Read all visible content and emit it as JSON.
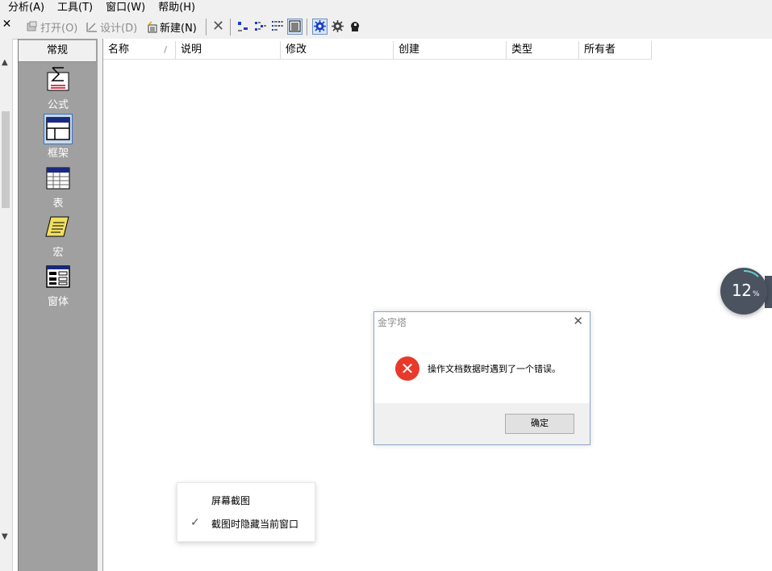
{
  "menu": [
    "分析(A)",
    "工具(T)",
    "窗口(W)",
    "帮助(H)"
  ],
  "toolbar": {
    "close_glyph": "✕",
    "open_label": "打开(O)",
    "design_label": "设计(D)",
    "new_label": "新建(N)",
    "delete_glyph": "✕"
  },
  "panel": {
    "tab": "常规",
    "items": [
      {
        "label": "公式",
        "icon": "formula-icon"
      },
      {
        "label": "框架",
        "icon": "frame-icon"
      },
      {
        "label": "表",
        "icon": "table-icon"
      },
      {
        "label": "宏",
        "icon": "macro-icon"
      },
      {
        "label": "窗体",
        "icon": "form-icon"
      }
    ],
    "selected_index": 1
  },
  "list": {
    "columns": [
      "名称",
      "说明",
      "修改",
      "创建",
      "类型",
      "所有者"
    ],
    "sort_indicator": "/",
    "rows": []
  },
  "dialog": {
    "title": "金字塔",
    "message": "操作文档数据时遇到了一个错误。",
    "ok_label": "确定",
    "icon": "error-icon"
  },
  "context_menu": {
    "items": [
      {
        "label": "屏幕截图",
        "checked": false
      },
      {
        "label": "截图时隐藏当前窗口",
        "checked": true
      }
    ]
  },
  "progress_widget": {
    "value": "12",
    "unit": "%"
  },
  "colors": {
    "panel_bg": "#a0a0a0",
    "error_red": "#e8392b",
    "widget_bg": "#4b5260"
  }
}
